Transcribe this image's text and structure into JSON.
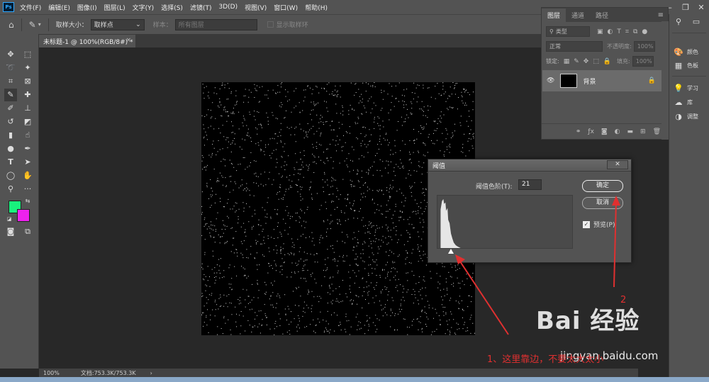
{
  "menu": {
    "logo": "Ps",
    "items": [
      "文件(F)",
      "编辑(E)",
      "图像(I)",
      "图层(L)",
      "文字(Y)",
      "选择(S)",
      "滤镜(T)",
      "3D(D)",
      "视图(V)",
      "窗口(W)",
      "帮助(H)"
    ]
  },
  "options": {
    "sample_size_label": "取样大小：",
    "sample_size_value": "取样点",
    "sample_label": "样本：",
    "sample_value": "所有图层",
    "show_ring_label": "显示取样环"
  },
  "document_tab": {
    "title": "未标题-1 @ 100%(RGB/8#) *",
    "close": "×"
  },
  "colors": {
    "foreground": "#19f27d",
    "background": "#ee22ee",
    "annotation": "#e03030"
  },
  "status": {
    "zoom": "100%",
    "doc_info": "文档:753.3K/753.3K",
    "arrow": "›"
  },
  "layers_panel": {
    "tabs": [
      "图层",
      "通道",
      "路径"
    ],
    "filter_kind": "类型",
    "blend_mode": "正常",
    "opacity_label": "不透明度:",
    "opacity_value": "100%",
    "lock_label": "锁定:",
    "fill_label": "填充:",
    "fill_value": "100%",
    "layer_name": "背景"
  },
  "side_panels": {
    "items": [
      {
        "icon": "palette-icon",
        "label": "颜色"
      },
      {
        "icon": "swatches-icon",
        "label": "色板"
      },
      {
        "icon": "learn-icon",
        "label": "学习"
      },
      {
        "icon": "libraries-icon",
        "label": "库"
      },
      {
        "icon": "adjustments-icon",
        "label": "调整"
      }
    ]
  },
  "threshold_dialog": {
    "title": "阈值",
    "level_label": "阈值色阶(T):",
    "level_value": "21",
    "ok_label": "确定",
    "cancel_label": "取消",
    "preview_label": "预览(P)",
    "preview_checked": true
  },
  "annotations": {
    "step1": "1、这里靠边，不要太大太小",
    "step2": "2"
  },
  "watermark": {
    "brand": "Bai 经验",
    "url": "jingyan.baidu.com"
  }
}
